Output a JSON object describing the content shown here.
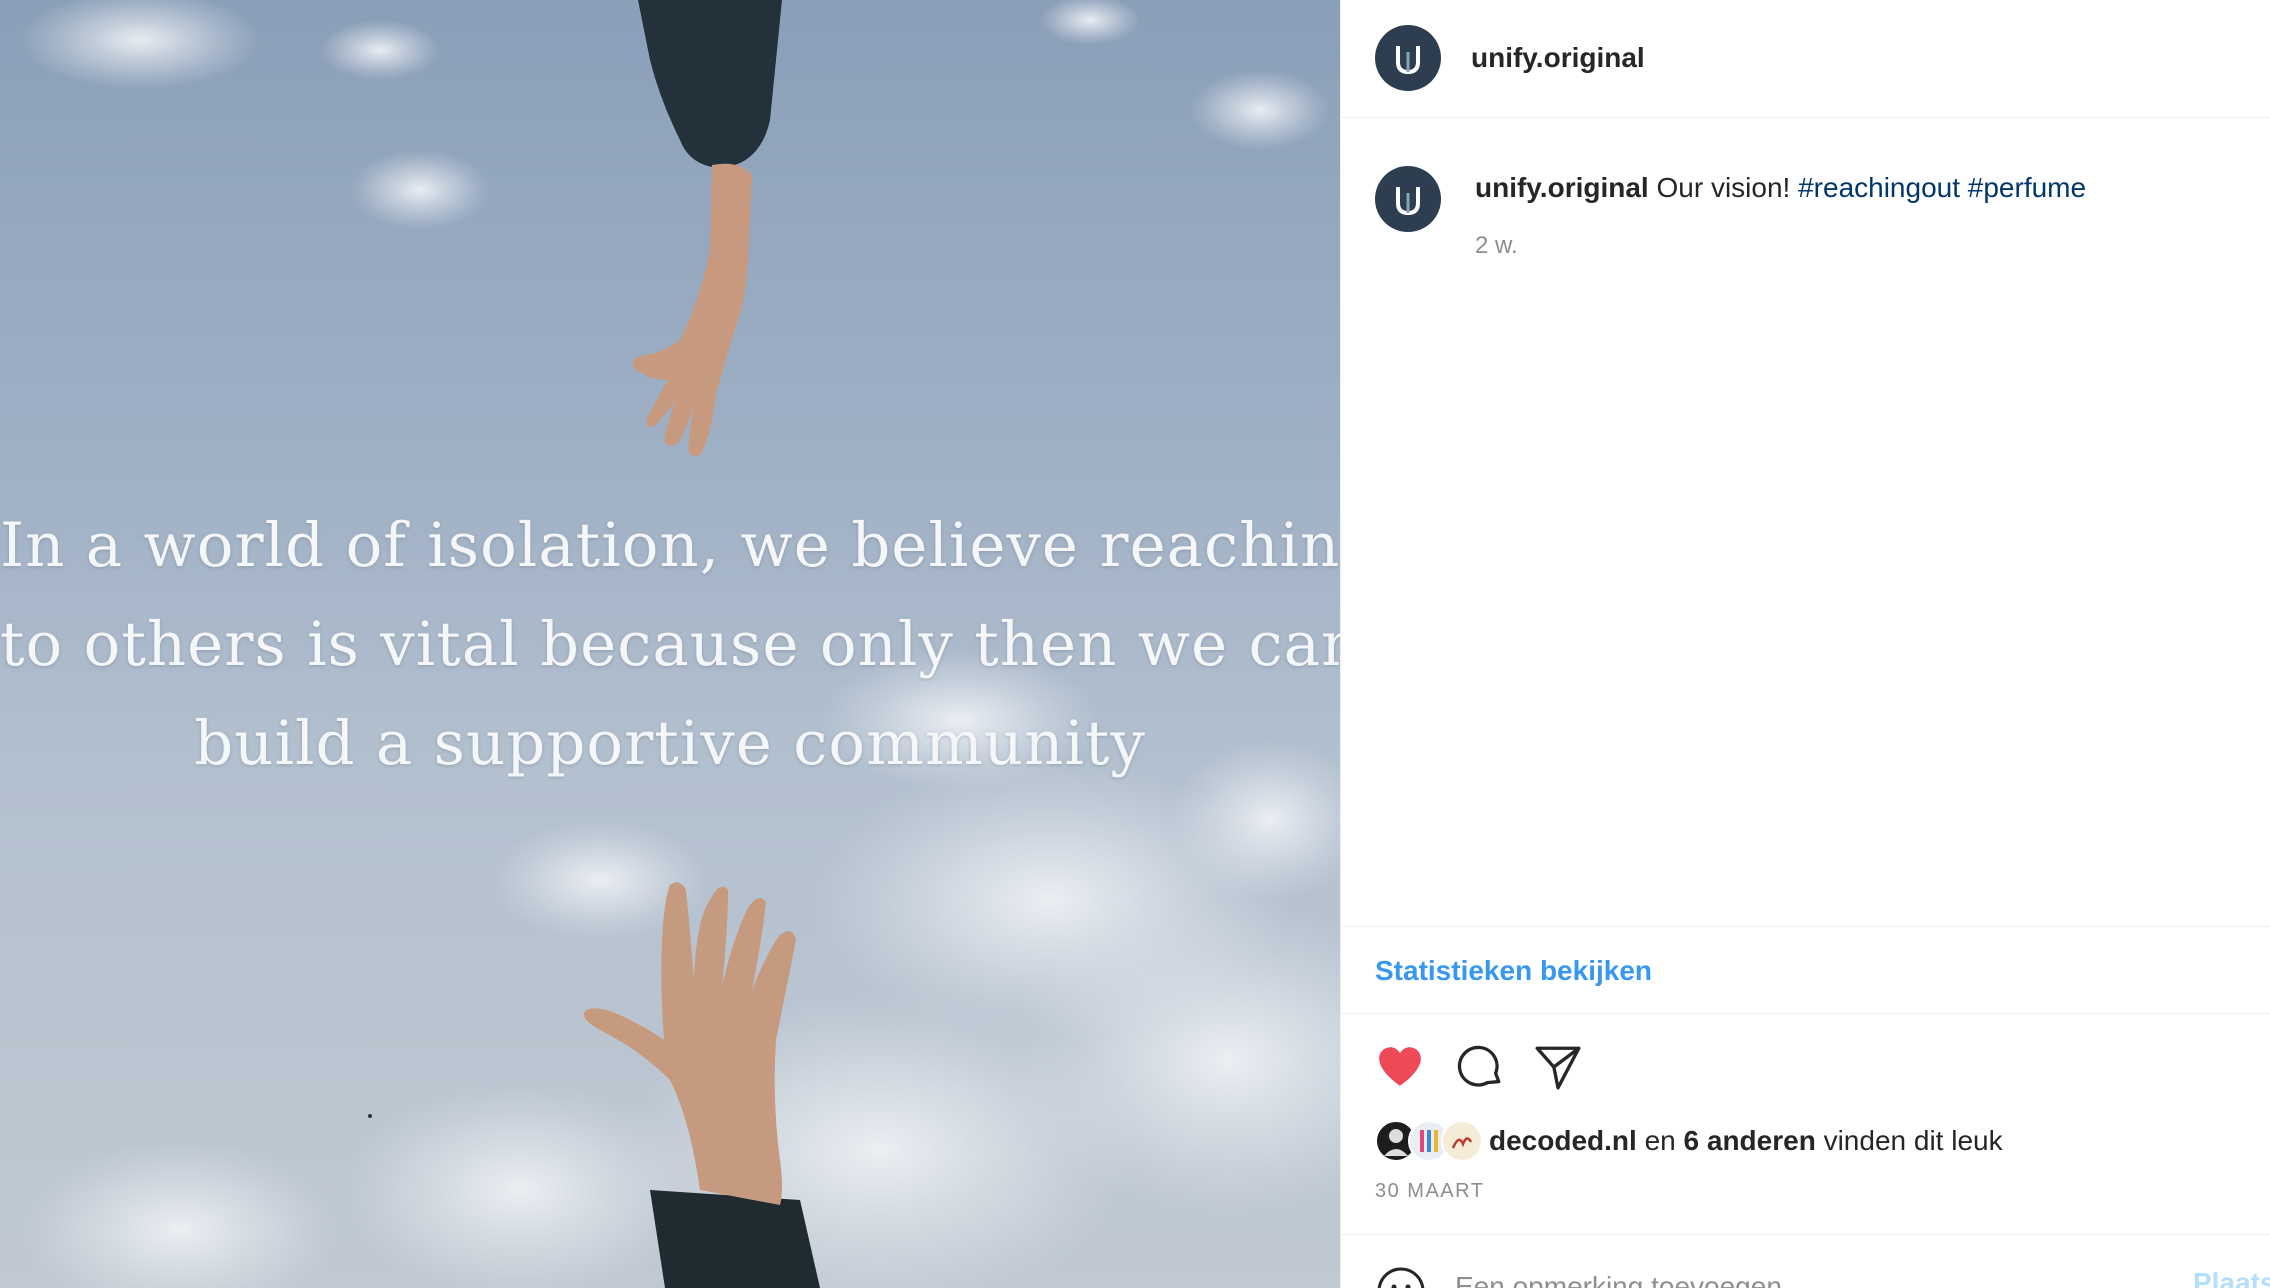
{
  "media": {
    "quote_lines": [
      "In a world of isolation, we believe reaching out",
      "to others is vital because only then we can",
      "build a supportive community"
    ]
  },
  "header": {
    "username": "unify.original"
  },
  "caption": {
    "username": "unify.original",
    "text": "Our vision!",
    "hashtags": [
      "#reachingout",
      "#perfume"
    ],
    "time": "2 w."
  },
  "insights": {
    "label": "Statistieken bekijken"
  },
  "actions": {
    "liked": true,
    "like_color": "#ed4956",
    "icons": [
      "heart-icon",
      "comment-icon",
      "share-icon"
    ]
  },
  "likes": {
    "first_liker": "decoded.nl",
    "connector": "en",
    "others": "6 anderen",
    "suffix": "vinden dit leuk"
  },
  "date": "30 MAART",
  "comment_box": {
    "placeholder": "Een opmerking toevoegen...",
    "post_label": "Plaatsen"
  },
  "colors": {
    "link_blue": "#3897f0",
    "hashtag": "#00376b",
    "avatar_bg": "#2c3e50"
  }
}
